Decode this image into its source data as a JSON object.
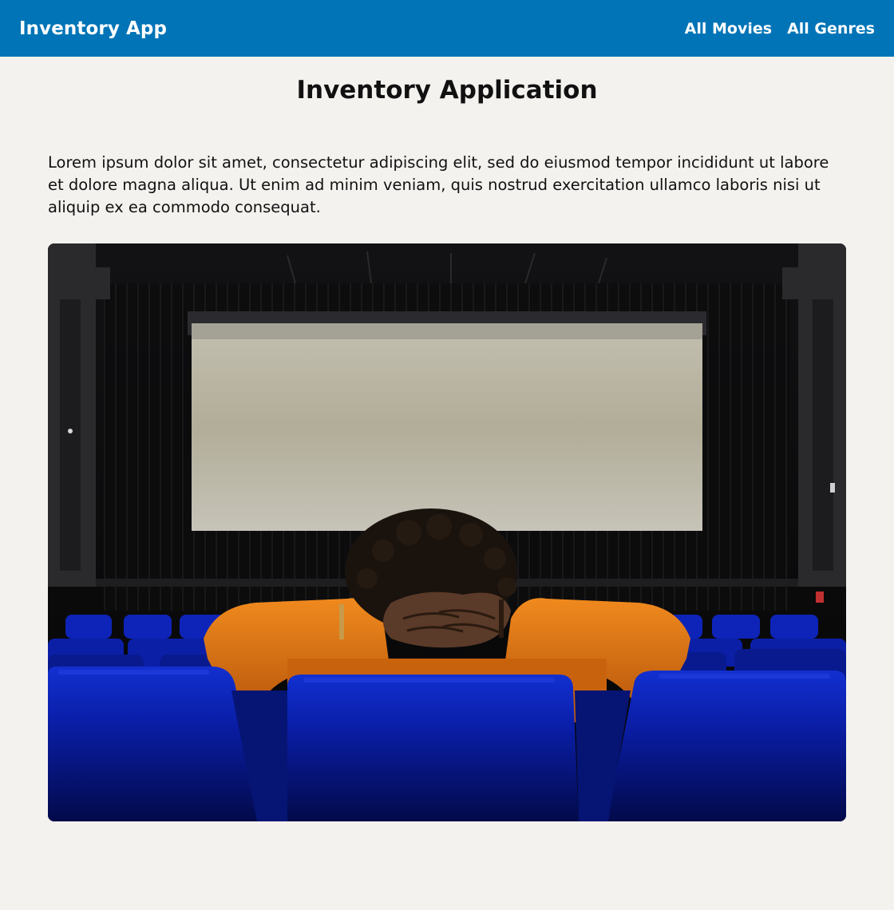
{
  "header": {
    "brand": "Inventory App",
    "nav": [
      {
        "label": "All Movies"
      },
      {
        "label": "All Genres"
      }
    ],
    "color": "#0074b7"
  },
  "main": {
    "title": "Inventory Application",
    "intro": "Lorem ipsum dolor sit amet, consectetur adipiscing elit, sed do eiusmod tempor incididunt ut labore et dolore magna aliqua. Ut enim ad minim veniam, quis nostrud exercitation ullamco laboris nisi ut aliquip ex ea commodo consequat."
  },
  "colors": {
    "background": "#f4f2ef",
    "seat": "#0a1ea8",
    "sweater": "#e8730f",
    "screen": "#b5b09c"
  }
}
